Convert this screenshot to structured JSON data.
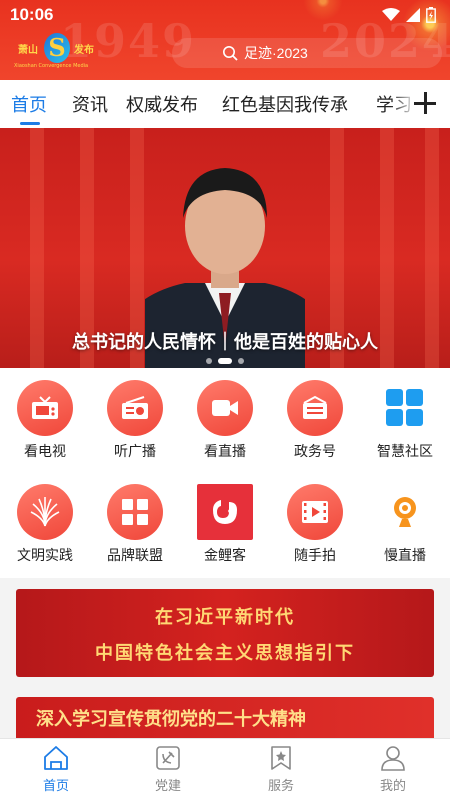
{
  "status_bar": {
    "time": "10:06"
  },
  "header": {
    "watermark_left": "1949",
    "watermark_right": "2024",
    "logo_cn_left": "萧山",
    "logo_cn_right": "发布",
    "logo_en": "Xiaoshan Convergence Media",
    "search_placeholder": "足迹·2023"
  },
  "tabs": [
    {
      "label": "首页",
      "active": true
    },
    {
      "label": "资讯"
    },
    {
      "label": "权威发布"
    },
    {
      "label": "红色基因我传承"
    },
    {
      "label": "学习"
    }
  ],
  "banner": {
    "caption": "总书记的人民情怀｜他是百姓的贴心人",
    "slides": 3,
    "current_slide": 2
  },
  "services": [
    {
      "label": "看电视",
      "icon": "tv-icon"
    },
    {
      "label": "听广播",
      "icon": "radio-icon"
    },
    {
      "label": "看直播",
      "icon": "live-video-icon"
    },
    {
      "label": "政务号",
      "icon": "newspaper-icon"
    },
    {
      "label": "智慧社区",
      "icon": "grid-blocks-icon"
    },
    {
      "label": "文明实践",
      "icon": "flower-icon"
    },
    {
      "label": "品牌联盟",
      "icon": "tiles-icon"
    },
    {
      "label": "金鲤客",
      "icon": "fish-logo-icon"
    },
    {
      "label": "随手拍",
      "icon": "film-play-icon"
    },
    {
      "label": "慢直播",
      "icon": "webcam-icon"
    }
  ],
  "feature_card": {
    "line1": "在习近平新时代",
    "line2": "中国特色社会主义思想指引下"
  },
  "feature_card_2": {
    "line1": "深入学习宣传贯彻党的二十大精神"
  },
  "bottom_nav": [
    {
      "label": "首页",
      "active": true
    },
    {
      "label": "党建"
    },
    {
      "label": "服务"
    },
    {
      "label": "我的"
    }
  ],
  "colors": {
    "accent": "#1c7ce6",
    "brand_red": "#e8321f"
  }
}
